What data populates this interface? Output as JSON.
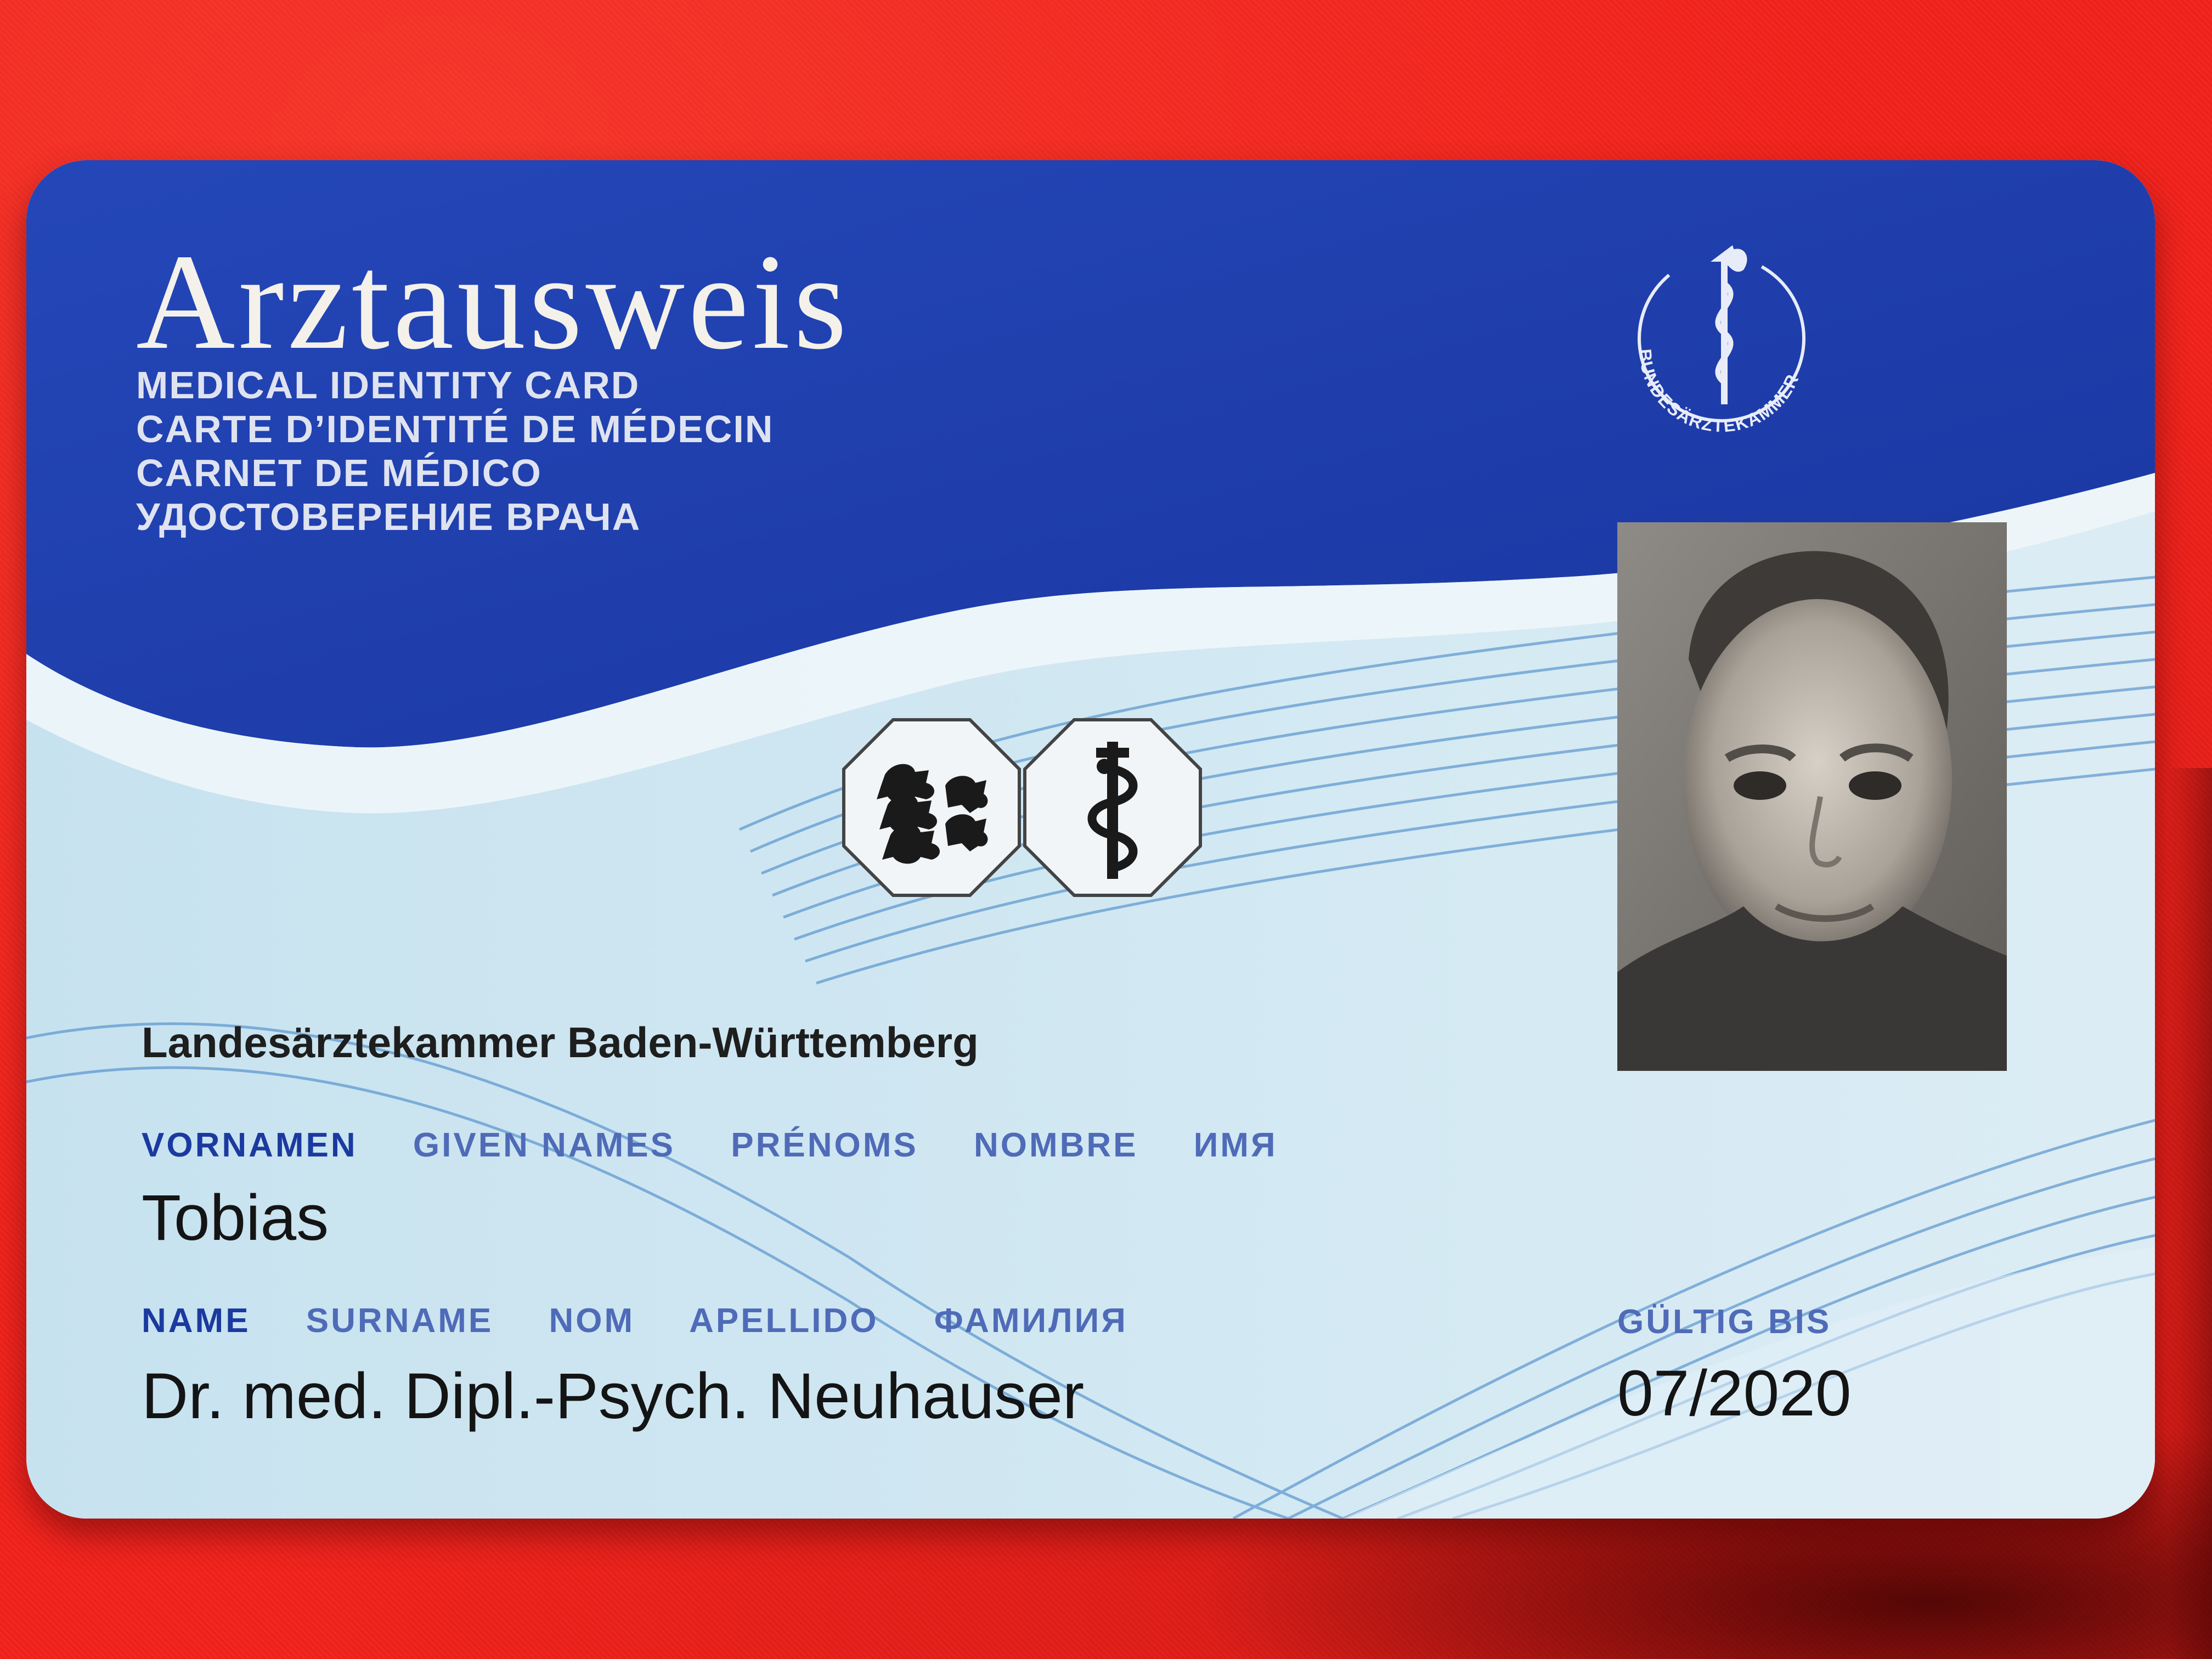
{
  "card": {
    "title": "Arztausweis",
    "subtitles": [
      "MEDICAL IDENTITY CARD",
      "CARTE D’IDENTITÉ DE MÉDECIN",
      "CARNET DE MÉDICO",
      "УДОСТОВЕРЕНИЕ ВРАЧА"
    ],
    "seal_text": "BUNDESÄRZTEKAMMER",
    "issuer": "Landesärztekammer Baden-Württemberg",
    "given_names_labels": [
      "VORNAMEN",
      "GIVEN NAMES",
      "PRÉNOMS",
      "NOMBRE",
      "ИМЯ"
    ],
    "given_names_value": "Tobias",
    "surname_labels": [
      "NAME",
      "SURNAME",
      "NOM",
      "APELLIDO",
      "ФАМИЛИЯ"
    ],
    "surname_value": "Dr. med. Dipl.-Psych. Neuhauser",
    "valid_label": "GÜLTIG BIS",
    "valid_value": "07/2020"
  },
  "colors": {
    "background": "#f2221c",
    "card_blue": "#1f3fae",
    "card_light": "#cfe6f1",
    "label_blue": "#1b3aa0"
  },
  "icons": [
    "caduceus-seal-icon",
    "coat-of-arms-icon",
    "staff-of-asclepius-icon"
  ]
}
